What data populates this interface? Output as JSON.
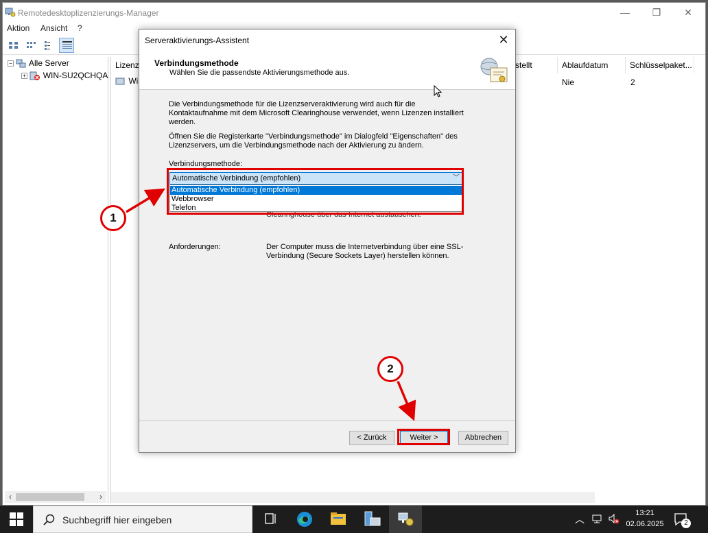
{
  "main_window": {
    "title": "Remotedesktoplizenzierungs-Manager",
    "controls": {
      "minimize": "—",
      "maximize": "❐",
      "close": "✕"
    }
  },
  "menu": {
    "items": [
      "Aktion",
      "Ansicht",
      "?"
    ]
  },
  "tree": {
    "root_label": "Alle Server",
    "server_label": "WIN-SU2QCHQA"
  },
  "list": {
    "columns": [
      "Lizenzv",
      "stellt",
      "Ablaufdatum",
      "Schlüsselpaket..."
    ],
    "row": {
      "name": "Win",
      "ablaufdatum": "Nie",
      "schluesselpaket": "2"
    }
  },
  "dialog": {
    "title": "Serveraktivierungs-Assistent",
    "close_glyph": "✕",
    "header_title": "Verbindungsmethode",
    "header_subtitle": "Wählen Sie die passendste Aktivierungsmethode aus.",
    "para1": "Die Verbindungsmethode für die Lizenzserveraktivierung wird auch für die Kontaktaufnahme mit dem Microsoft Clearinghouse verwendet, wenn Lizenzen installiert werden.",
    "para2": "Öffnen Sie die Registerkarte \"Verbindungsmethode\" im Dialogfeld \"Eigenschaften\" des Lizenzservers, um die Verbindungsmethode nach der Aktivierung zu ändern.",
    "method_label": "Verbindungsmethode:",
    "method_selected": "Automatische Verbindung (empfohlen)",
    "method_options": [
      "Automatische Verbindung (empfohlen)",
      "Webbrowser",
      "Telefon"
    ],
    "hint_behind": "Clearinghouse über das Internet austauschen.",
    "requirements_label": "Anforderungen:",
    "requirements_text": "Der Computer muss die Internetverbindung über eine SSL-Verbindung (Secure Sockets Layer) herstellen können.",
    "back_button": "< Zurück",
    "next_button": "Weiter >",
    "cancel_button": "Abbrechen"
  },
  "annotations": {
    "callout1": "1",
    "callout2": "2",
    "highlight_color": "#e00000"
  },
  "taskbar": {
    "search_placeholder": "Suchbegriff hier eingeben",
    "time": "13:21",
    "date": "02.06.2025",
    "notification_count": "2"
  }
}
